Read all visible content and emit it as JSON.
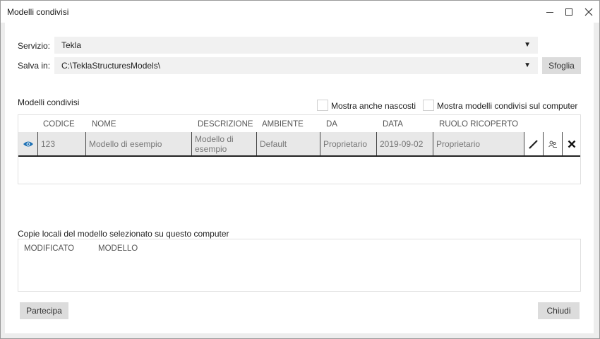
{
  "window": {
    "title": "Modelli condivisi"
  },
  "service": {
    "label": "Servizio:",
    "value": "Tekla"
  },
  "save": {
    "label": "Salva in:",
    "value": "C:\\TeklaStructuresModels\\",
    "browse_label": "Sfoglia"
  },
  "shared": {
    "title": "Modelli condivisi",
    "show_hidden_label": "Mostra anche nascosti",
    "show_on_computer_label": "Mostra modelli condivisi sul computer",
    "columns": [
      "CODICE",
      "NOME",
      "DESCRIZIONE",
      "AMBIENTE",
      "DA",
      "DATA",
      "RUOLO RICOPERTO"
    ],
    "row": {
      "code": "123",
      "name": "Modello di esempio",
      "description": "Modello di esempio",
      "environment": "Default",
      "from": "Proprietario",
      "date": "2019-09-02",
      "role": "Proprietario"
    }
  },
  "local": {
    "title": "Copie locali del modello selezionato su questo computer",
    "columns": [
      "MODIFICATO",
      "MODELLO"
    ]
  },
  "footer": {
    "join_label": "Partecipa",
    "close_label": "Chiudi"
  },
  "colors": {
    "accent": "#1a6fb3",
    "button": "#dcdcdc",
    "field": "#f1f1f1"
  }
}
